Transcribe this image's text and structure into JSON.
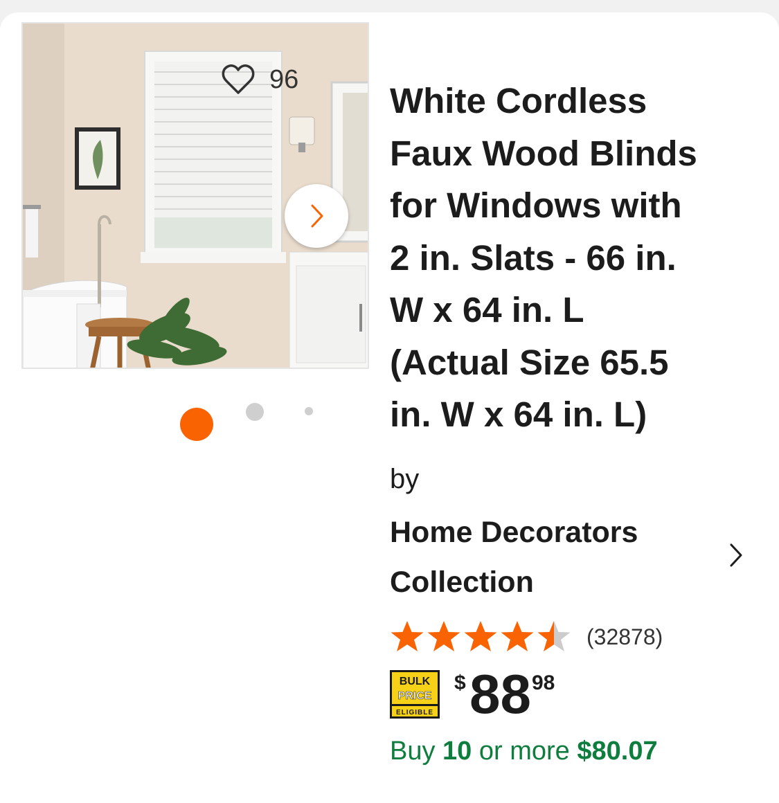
{
  "gallery": {
    "favorite_count": "96",
    "slide_count": 3,
    "active_slide": 1
  },
  "product": {
    "title": "White Cordless Faux Wood Blinds for Windows with 2 in. Slats - 66 in. W x 64 in. L (Actual Size 65.5 in. W x 64 in. L)",
    "title_lines": [
      "White Cordless",
      "Faux Wood Blinds",
      "for Windows with",
      "2 in. Slats - 66 in.",
      "W x 64 in. L",
      "(Actual Size 65.5",
      "in. W x 64 in. L)"
    ],
    "by_label": "by",
    "brand_lines": [
      "Home Decorators",
      "Collection"
    ]
  },
  "rating": {
    "value": 4.5,
    "max": 5,
    "review_count": "(32878)"
  },
  "badge": {
    "line1": "BULK",
    "line2": "PRICE",
    "line3": "ELIGIBLE"
  },
  "price": {
    "currency": "$",
    "dollars": "88",
    "cents": "98"
  },
  "bulk_offer": {
    "prefix": "Buy",
    "quantity": "10",
    "middle": "or more",
    "price": "$80.07"
  },
  "colors": {
    "accent": "#f96302",
    "green": "#0f7d3e",
    "badge_yellow": "#f7d117"
  }
}
